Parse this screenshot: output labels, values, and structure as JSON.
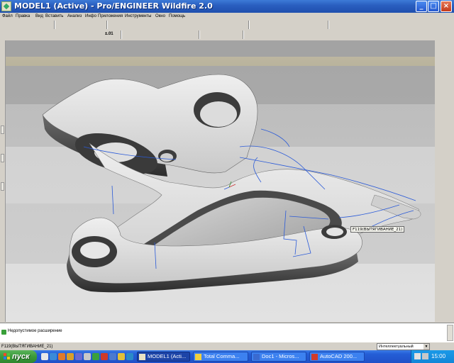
{
  "window": {
    "title": "MODEL1 (Active) - Pro/ENGINEER Wildfire 2.0",
    "minimize_glyph": "_",
    "maximize_glyph": "□",
    "close_glyph": "×"
  },
  "menu": {
    "file": "Файл",
    "edit": "Правка",
    "view": "Вид",
    "insert": "Вставить",
    "analysis": "Анализ",
    "info": "Инфо",
    "applications": "Приложения",
    "tools": "Инструменты",
    "window": "Окно",
    "help": "Помощь"
  },
  "toolbar": {
    "coord_label": "±.01"
  },
  "viewport": {
    "feature_tag": "F119(ВЫТЯГИВАНИЕ_21)"
  },
  "message": {
    "text": "Недопустимое расширение"
  },
  "status": {
    "text": "F119(ВЫТЯГИВАНИЕ_21)",
    "filter_value": "Интеллектуальный"
  },
  "taskbar": {
    "start_label": "пуск",
    "items": [
      {
        "label": "MODEL1 (Acti...",
        "icon_color": "#e9e2c4"
      },
      {
        "label": "Total Comma...",
        "icon_color": "#f0d040"
      },
      {
        "label": "Doc1 - Micros...",
        "icon_color": "#3a6ad0"
      },
      {
        "label": "AutoCAD 200...",
        "icon_color": "#d03a2a"
      }
    ],
    "clock": "15:00"
  }
}
